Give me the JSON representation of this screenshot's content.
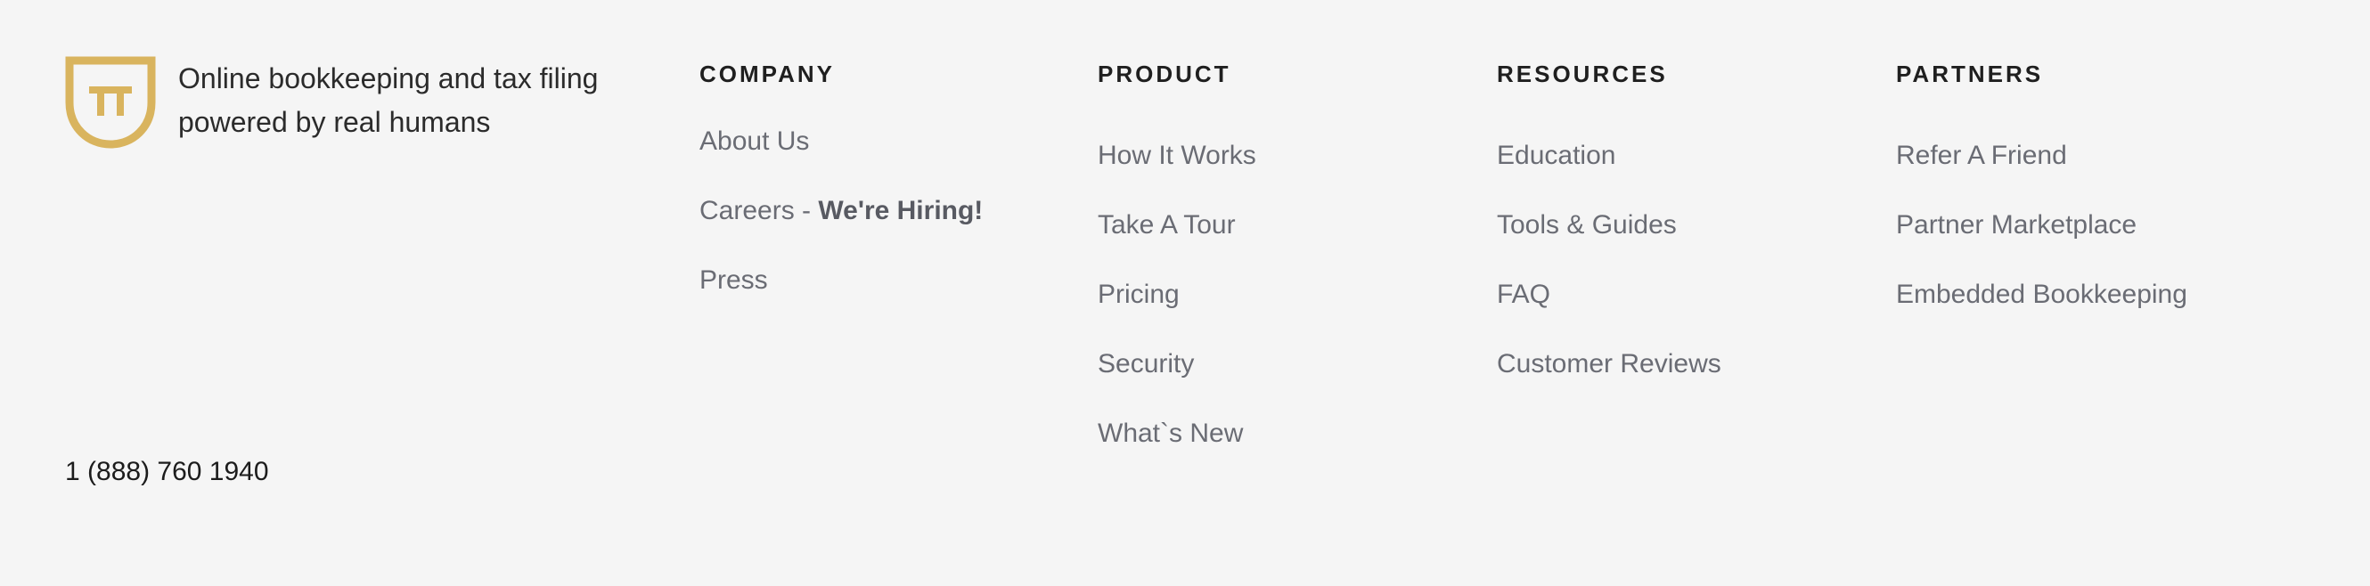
{
  "brand": {
    "logo_icon": "pi-shield-logo-icon",
    "tagline": "Online bookkeeping and tax filing powered by real humans",
    "phone": "1 (888) 760 1940",
    "accent_color": "#d9b45e"
  },
  "columns": {
    "company": {
      "heading": "COMPANY",
      "items": [
        {
          "label": "About Us"
        },
        {
          "label": "Careers - ",
          "emphasis": "We're Hiring!"
        },
        {
          "label": "Press"
        }
      ]
    },
    "product": {
      "heading": "PRODUCT",
      "items": [
        {
          "label": "How It Works"
        },
        {
          "label": "Take A Tour"
        },
        {
          "label": "Pricing"
        },
        {
          "label": "Security"
        },
        {
          "label": "What`s New"
        }
      ]
    },
    "resources": {
      "heading": "RESOURCES",
      "items": [
        {
          "label": "Education"
        },
        {
          "label": "Tools & Guides"
        },
        {
          "label": "FAQ"
        },
        {
          "label": "Customer Reviews"
        }
      ]
    },
    "partners": {
      "heading": "PARTNERS",
      "items": [
        {
          "label": "Refer A Friend"
        },
        {
          "label": "Partner Marketplace"
        },
        {
          "label": "Embedded Bookkeeping"
        }
      ]
    }
  },
  "colors": {
    "background": "#f5f5f5",
    "link": "#6a6c74",
    "heading": "#1f1f1f"
  }
}
